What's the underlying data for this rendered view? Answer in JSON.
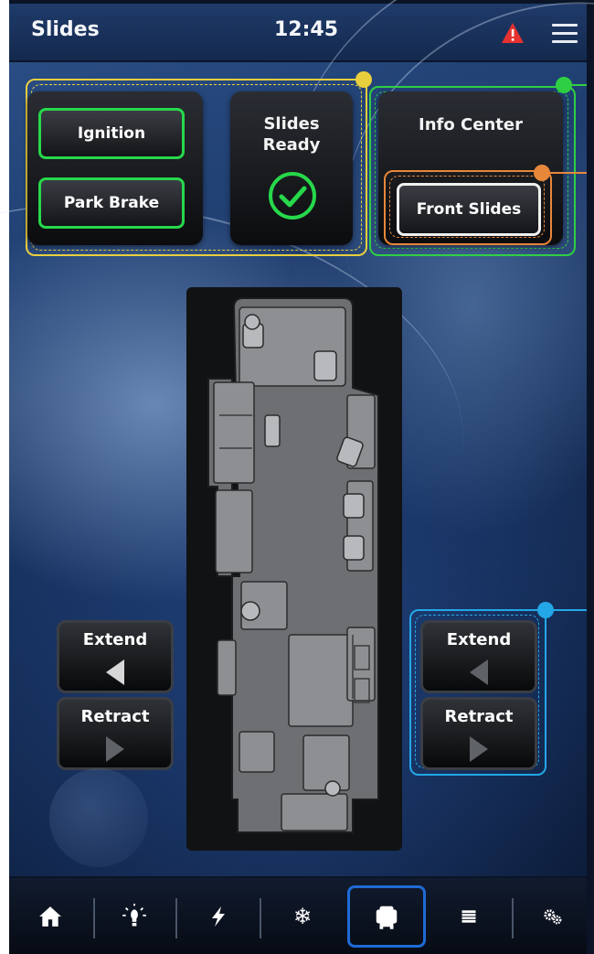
{
  "header": {
    "title": "Slides",
    "time": "12:45",
    "warning_icon": "warning-icon",
    "menu_icon": "menu-icon"
  },
  "status_panel": {
    "ignition_label": "Ignition",
    "park_brake_label": "Park Brake",
    "slides_ready_label": "Slides Ready",
    "slides_ready_icon": "check-circle-icon"
  },
  "info_center": {
    "title": "Info Center",
    "selected_slide_label": "Front Slides"
  },
  "left_slide_controls": {
    "extend_label": "Extend",
    "retract_label": "Retract"
  },
  "right_slide_controls": {
    "extend_label": "Extend",
    "retract_label": "Retract"
  },
  "bottom_nav": {
    "items": [
      {
        "icon": "home-icon"
      },
      {
        "icon": "lighting-icon"
      },
      {
        "icon": "power-icon"
      },
      {
        "icon": "climate-icon"
      },
      {
        "icon": "slides-icon",
        "active": true
      },
      {
        "icon": "shades-icon"
      },
      {
        "icon": "settings-icon"
      }
    ]
  },
  "colors": {
    "ok_green": "#27d84b",
    "warning_red": "#e5312f",
    "active_blue": "#1e6ad6",
    "annotation_yellow": "#e9cf3e",
    "annotation_green": "#2fcf44",
    "annotation_orange": "#e6873a",
    "annotation_blue": "#23a7e6"
  }
}
